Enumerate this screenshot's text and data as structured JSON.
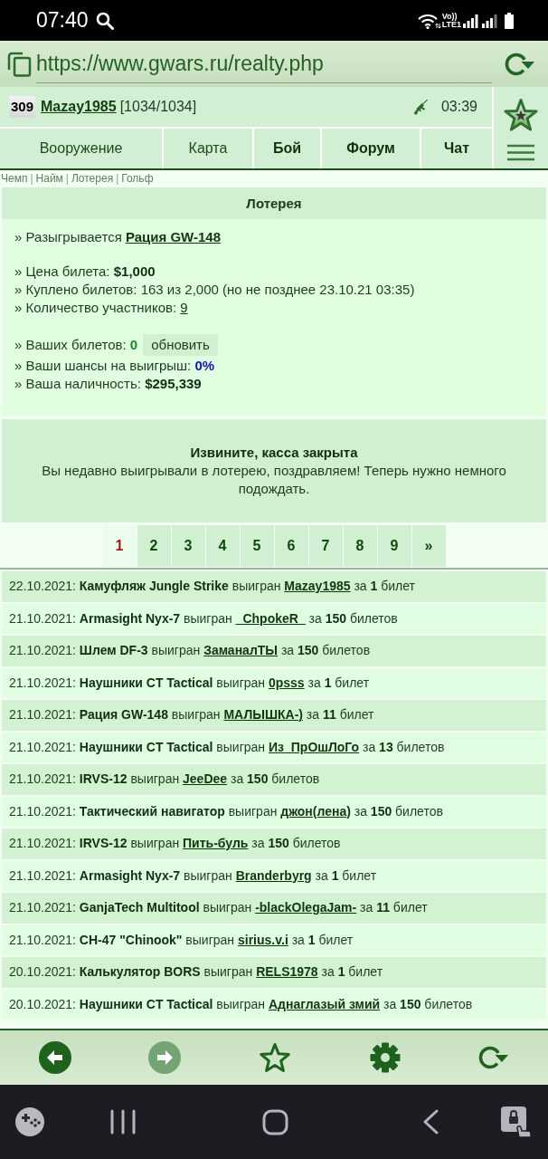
{
  "status_bar": {
    "time": "07:40",
    "network_top": "Vo))",
    "network_bottom": "LTE1"
  },
  "address_bar": {
    "url": "https://www.gwars.ru/realty.php"
  },
  "user_bar": {
    "level": "309",
    "username": "Mazay1985",
    "hp": "[1034/1034]",
    "timer": "03:39"
  },
  "nav_tabs": [
    {
      "label": "Вооружение",
      "highlighted": false
    },
    {
      "label": "Карта",
      "highlighted": false
    },
    {
      "label": "Бой",
      "highlighted": true
    },
    {
      "label": "Форум",
      "highlighted": true
    },
    {
      "label": "Чат",
      "highlighted": true
    }
  ],
  "breadcrumb": {
    "separator": "|",
    "links": [
      "Чемп",
      "Найм",
      "Лотерея",
      "Гольф"
    ]
  },
  "lottery": {
    "title": "Лотерея",
    "groups": [
      {
        "lines": [
          {
            "kind": "prize_link",
            "text": "» Разыгрывается",
            "value": "Рация GW-148"
          }
        ]
      },
      {
        "lines": [
          {
            "kind": "amount",
            "text": "» Цена билета:",
            "value": "$1,000"
          },
          {
            "kind": "plain",
            "text": "» Куплено билетов: 163 из 2,000 (но не позднее 23.10.21 03:35)"
          },
          {
            "kind": "count_link",
            "text": "» Количество участников:",
            "value": "9"
          }
        ]
      },
      {
        "lines": [
          {
            "kind": "tickets",
            "text": "» Ваших билетов:",
            "value": "0",
            "button": "обновить"
          },
          {
            "kind": "chance",
            "text": "» Ваши шансы на выигрыш:",
            "value": "0%"
          },
          {
            "kind": "amount",
            "text": "» Ваша наличность:",
            "value": "$295,339"
          }
        ]
      }
    ]
  },
  "notice": {
    "title": "Извините, касса закрыта",
    "message": "Вы недавно выигрывали в лотерею, поздравляем! Теперь нужно немного подождать."
  },
  "pagination": [
    {
      "label": "1",
      "selected": true
    },
    {
      "label": "2",
      "selected": false
    },
    {
      "label": "3",
      "selected": false
    },
    {
      "label": "4",
      "selected": false
    },
    {
      "label": "5",
      "selected": false
    },
    {
      "label": "6",
      "selected": false
    },
    {
      "label": "7",
      "selected": false
    },
    {
      "label": "8",
      "selected": false
    },
    {
      "label": "9",
      "selected": false
    },
    {
      "label": "»",
      "selected": false
    }
  ],
  "winners": [
    {
      "before": "22.10.2021: **Камуфляж Jungle Strike** выигран",
      "winner": "Mazay1985",
      "after": "за **1** билет"
    },
    {
      "before": "21.10.2021: **Armasight Nyx-7** выигран",
      "winner": "_ChpokeR_",
      "after": "за **150** билетов"
    },
    {
      "before": "21.10.2021: **Шлем DF-3** выигран",
      "winner": "ЗаманалТЫ",
      "after": "за **150** билетов"
    },
    {
      "before": "21.10.2021: **Наушники CT Tactical** выигран",
      "winner": "0psss",
      "after": "за **1** билет"
    },
    {
      "before": "21.10.2021: **Рация GW-148** выигран",
      "winner": "МАЛЫШКА-)",
      "after": "за **11** билет"
    },
    {
      "before": "21.10.2021: **Наушники CT Tactical** выигран",
      "winner": "Из_ПрОшЛоГо",
      "after": "за **13** билетов"
    },
    {
      "before": "21.10.2021: **IRVS-12** выигран",
      "winner": "JeeDee",
      "after": "за **150** билетов"
    },
    {
      "before": "21.10.2021: **Тактический навигатор** выигран",
      "winner": "джон(лена)",
      "after": "за **150** билетов"
    },
    {
      "before": "21.10.2021: **IRVS-12** выигран",
      "winner": "Пить-буль",
      "after": "за **150** билетов"
    },
    {
      "before": "21.10.2021: **Armasight Nyx-7** выигран",
      "winner": "Branderbyrg",
      "after": "за **1** билет"
    },
    {
      "before": "21.10.2021: **GanjaTech Multitool** выигран",
      "winner": "-blackOlegaJam-",
      "after": "за **11** билет"
    },
    {
      "before": "21.10.2021: **CH-47 \"Chinook\"** выигран",
      "winner": "sirius.v.i",
      "after": "за **1** билет"
    },
    {
      "before": "20.10.2021: **Калькулятор BORS** выигран",
      "winner": "RELS1978",
      "after": "за **1** билет"
    },
    {
      "before": "20.10.2021: **Наушники CT Tactical** выигран",
      "winner": "Аднаглазый змий",
      "after": "за **150** билетов"
    }
  ],
  "bottom_toolbar": [
    {
      "kind": "back",
      "disabled": false
    },
    {
      "kind": "forward",
      "disabled": true
    },
    {
      "kind": "favorite",
      "disabled": false
    },
    {
      "kind": "settings",
      "disabled": false
    },
    {
      "kind": "reload",
      "disabled": false
    }
  ]
}
